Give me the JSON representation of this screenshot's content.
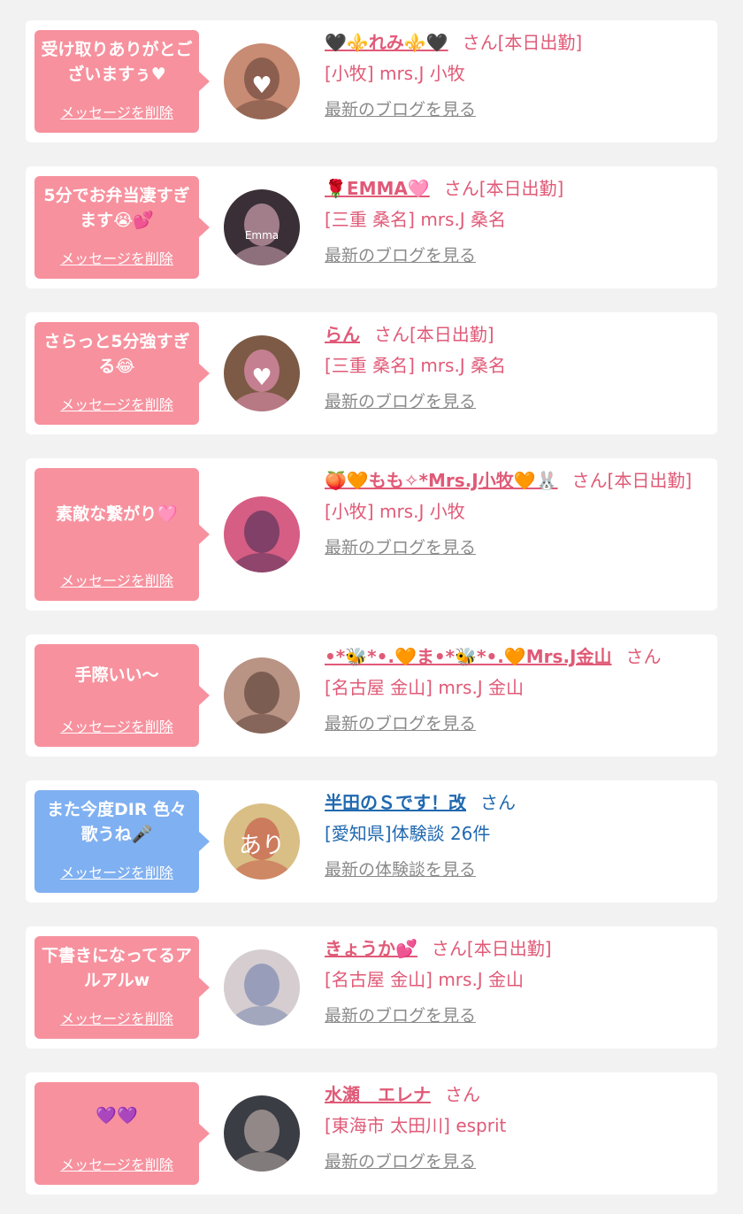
{
  "delete_label": "メッセージを削除",
  "items": [
    {
      "message": "受け取りありがとございますぅ♥",
      "name": "🖤⚜️れみ⚜️🖤",
      "suffix": "さん[本日出勤]",
      "shop": "[小牧] mrs.J 小牧",
      "link": "最新のブログを見る",
      "bubble": "pink",
      "theme": "pink",
      "avatar": {
        "bg": "#c88b73",
        "fg": "#5b3b31",
        "mark": "♥"
      }
    },
    {
      "message": "5分でお弁当凄すぎます😭💕",
      "name": "🌹EMMA🩷",
      "suffix": "さん[本日出勤]",
      "shop": "[三重 桑名] mrs.J 桑名",
      "link": "最新のブログを見る",
      "bubble": "pink",
      "theme": "pink",
      "avatar": {
        "bg": "#3a2f36",
        "fg": "#f5c0d0",
        "mark": "Emma"
      }
    },
    {
      "message": "さらっと5分強すぎる😂",
      "name": "らん",
      "suffix": "さん[本日出勤]",
      "shop": "[三重 桑名] mrs.J 桑名",
      "link": "最新のブログを見る",
      "bubble": "pink",
      "theme": "pink",
      "avatar": {
        "bg": "#7c5a45",
        "fg": "#ff9fd0",
        "mark": "♥"
      }
    },
    {
      "message": "素敵な繋がり🩷",
      "name": "🍑🧡もも✧*Mrs.J小牧🧡🐰",
      "suffix": "さん[本日出勤]",
      "shop": "[小牧] mrs.J 小牧",
      "link": "最新のブログを見る",
      "bubble": "pink",
      "theme": "pink",
      "avatar": {
        "bg": "#d65d84",
        "fg": "#3a2850",
        "mark": ""
      }
    },
    {
      "message": "手際いい〜",
      "name": "•*🐝*•.🧡ま•*🐝*•.🧡Mrs.J金山",
      "suffix": "さん",
      "shop": "[名古屋 金山] mrs.J 金山",
      "link": "最新のブログを見る",
      "bubble": "pink",
      "theme": "pink",
      "avatar": {
        "bg": "#b99384",
        "fg": "#4a3129",
        "mark": ""
      }
    },
    {
      "message": "また今度DIR 色々歌うね🎤",
      "name": "半田のＳです！改",
      "suffix": "さん",
      "shop": "[愛知県]体験談 26件",
      "link": "最新の体験談を見る",
      "bubble": "blue",
      "theme": "blue",
      "avatar": {
        "bg": "#d9bf86",
        "fg": "#c2443c",
        "mark": "あり"
      }
    },
    {
      "message": "下書きになってるアルアルw",
      "name": "きょうか💕",
      "suffix": "さん[本日出勤]",
      "shop": "[名古屋 金山] mrs.J 金山",
      "link": "最新のブログを見る",
      "bubble": "pink",
      "theme": "pink",
      "avatar": {
        "bg": "#d5cdd0",
        "fg": "#6679a8",
        "mark": ""
      }
    },
    {
      "message": "💜💜",
      "name": "水瀬　エレナ",
      "suffix": "さん",
      "shop": "[東海市 太田川] esprit",
      "link": "最新のブログを見る",
      "bubble": "pink",
      "theme": "pink",
      "avatar": {
        "bg": "#3b3d44",
        "fg": "#d9c7bf",
        "mark": ""
      }
    }
  ]
}
